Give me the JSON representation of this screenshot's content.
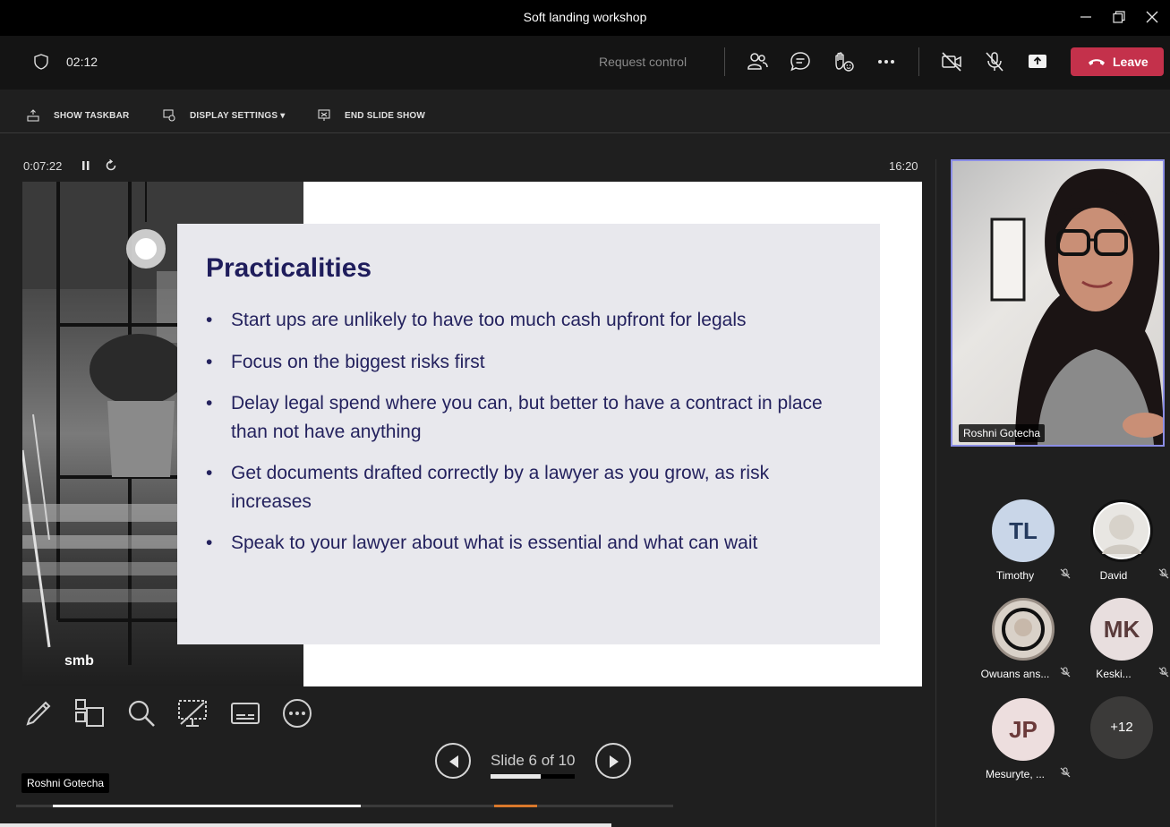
{
  "window": {
    "title": "Soft landing workshop"
  },
  "meeting": {
    "duration": "02:12",
    "request_control": "Request control",
    "leave_label": "Leave"
  },
  "presenter_toolbar": {
    "show_taskbar": "SHOW TASKBAR",
    "display_settings": "DISPLAY SETTINGS ▾",
    "end_slide_show": "END SLIDE SHOW"
  },
  "presenter": {
    "elapsed": "0:07:22",
    "clock": "16:20",
    "slide_counter": "Slide 6 of 10",
    "current_slide": 6,
    "total_slides": 10
  },
  "slide": {
    "logo": "smb",
    "title": "Practicalities",
    "bullets": [
      "Start ups are unlikely to have too much cash upfront for legals",
      "Focus on the biggest risks first",
      "Delay legal spend where you can, but better to have a contract in place than not have anything",
      "Get documents drafted correctly by a lawyer as you grow, as risk increases",
      "Speak to your lawyer about what is essential and what can wait"
    ]
  },
  "speaker": {
    "name": "Roshni Gotecha"
  },
  "attendees": [
    {
      "initials": "TL",
      "name": "Timothy",
      "avatar_color": "#c9d6e8",
      "text_color": "#243a5e"
    },
    {
      "initials": "",
      "name": "David",
      "avatar_color": "#ffffff",
      "text_color": "#000000"
    },
    {
      "initials": "",
      "name": "Owuans ans...",
      "avatar_color": "#d9d1c8",
      "text_color": "#000000"
    },
    {
      "initials": "MK",
      "name": "Keski...",
      "avatar_color": "#e8dede",
      "text_color": "#5a3b3b"
    },
    {
      "initials": "JP",
      "name": "Mesuryte, ...",
      "avatar_color": "#eddede",
      "text_color": "#6b3a3a"
    },
    {
      "initials": "+12",
      "name": "",
      "avatar_color": "#3b3a39",
      "text_color": "#ffffff"
    }
  ],
  "screen_share_label": "Roshni Gotecha",
  "colors": {
    "leave_red": "#c4314b",
    "slide_title": "#1f1d5c",
    "active_speaker_border": "#8b8ee6"
  }
}
